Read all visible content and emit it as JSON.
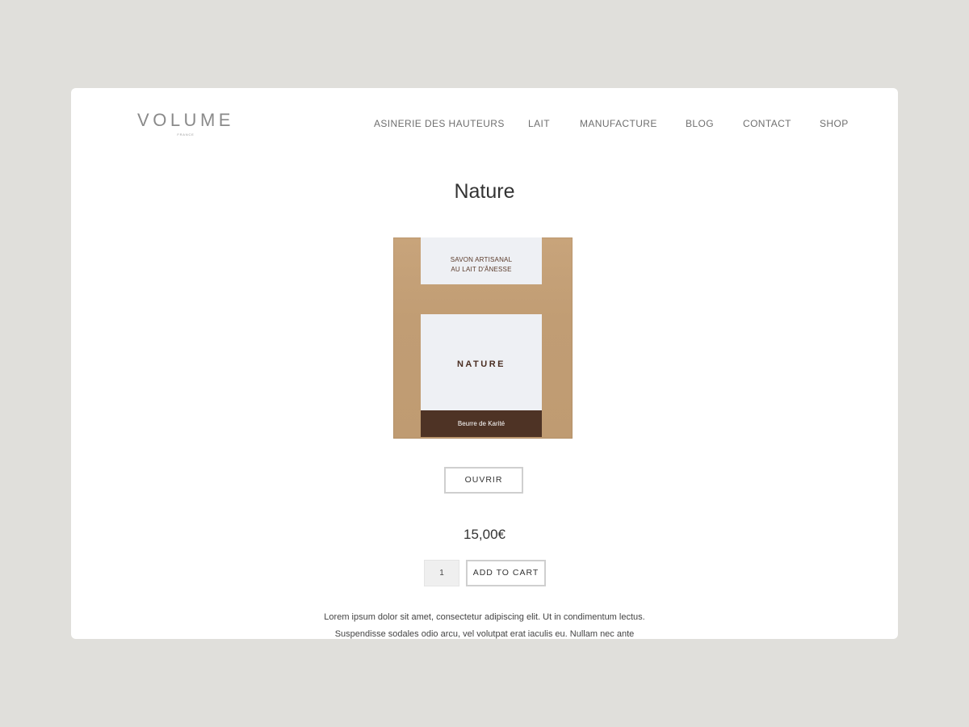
{
  "header": {
    "logo": {
      "word": "VOLUME",
      "sub": "FRANCE"
    },
    "nav": [
      {
        "label": "ASINERIE DES HAUTEURS"
      },
      {
        "label": "LAIT"
      },
      {
        "label": "MANUFACTURE"
      },
      {
        "label": "BLOG"
      },
      {
        "label": "CONTACT"
      },
      {
        "label": "SHOP"
      }
    ]
  },
  "product": {
    "title": "Nature",
    "image": {
      "top_label_line1": "SAVON ARTISANAL",
      "top_label_line2": "AU LAIT D'ÂNESSE",
      "main_label_name": "NATURE",
      "main_label_band": "Beurre de Karité"
    },
    "open_button": "OUVRIR",
    "price": "15,00€",
    "quantity": "1",
    "add_to_cart": "ADD TO CART",
    "description_line1": "Lorem ipsum dolor sit amet, consectetur adipiscing elit. Ut in condimentum lectus.",
    "description_line2": "Suspendisse sodales odio arcu, vel volutpat erat iaculis eu. Nullam nec ante"
  },
  "colors": {
    "page_background": "#e0dfdb",
    "card_background": "#ffffff",
    "kraft_box": "#c4a078",
    "label_band": "#4e3325"
  }
}
